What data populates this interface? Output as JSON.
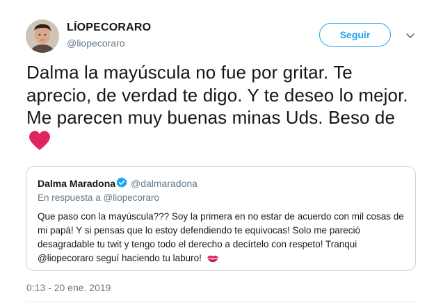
{
  "author": {
    "name": "LÍOPECORARO",
    "handle": "@liopecoraro"
  },
  "follow_button": {
    "label": "Seguir"
  },
  "more_menu": {
    "icon": "chevron-down-icon"
  },
  "tweet": {
    "text": "Dalma la mayúscula no fue por gritar. Te aprecio, de verdad te digo. Y te deseo lo mejor. Me parecen muy buenas minas Uds. Beso de",
    "emoji": "red-heart-icon",
    "timestamp": "0:13 - 20 ene. 2019"
  },
  "quoted_tweet": {
    "name": "Dalma Maradona",
    "verified": true,
    "handle": "@dalmaradona",
    "reply_to": "En respuesta a @liopecoraro",
    "text": "Que paso con la mayúscula??? Soy la primera en no estar de acuerdo con mil cosas de mi papá! Y si pensas que lo estoy defendiendo te equivocas! Solo me pareció desagradable tu twit y tengo todo el derecho a decírtelo con respeto! Tranqui @liopecoraro seguí haciendo tu laburo!",
    "emoji": "kiss-mark-icon"
  },
  "colors": {
    "accent": "#1da1f2",
    "text": "#14171a",
    "secondary": "#657786",
    "border": "#ccd6dd",
    "heart": "#e0245e"
  }
}
